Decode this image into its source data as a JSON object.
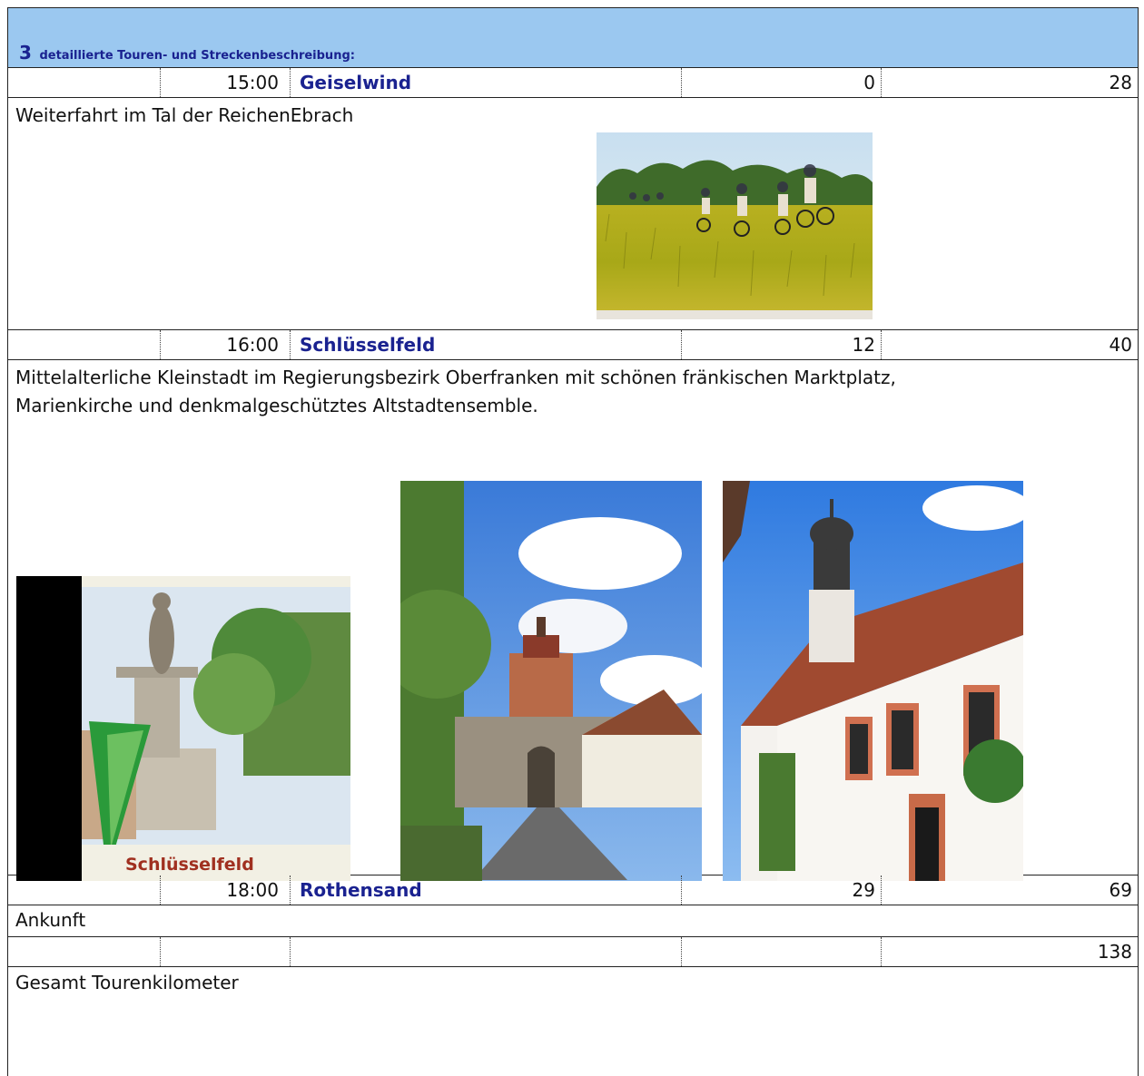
{
  "header": {
    "number": "3",
    "title": "detaillierte Touren- und Streckenbeschreibung:"
  },
  "stops": [
    {
      "time": "15:00",
      "place": "Geiselwind",
      "km": "0",
      "total": "28",
      "description": "Weiterfahrt im Tal der ReichenEbrach"
    },
    {
      "time": "16:00",
      "place": "Schlüsselfeld",
      "km": "12",
      "total": "40",
      "description_line1": "Mittelalterliche Kleinstadt im Regierungsbezirk Oberfranken mit schönen fränkischen Marktplatz,",
      "description_line2": "Marienkirche und denkmalgeschütztes Altstadtensemble.",
      "logo_text": "Schlüsselfeld"
    },
    {
      "time": "18:00",
      "place": "Rothensand",
      "km": "29",
      "total": "69",
      "description": "Ankunft"
    }
  ],
  "summary": {
    "total": "138",
    "label": "Gesamt Tourenkilometer"
  },
  "colors": {
    "header_bg": "#9bc8f0",
    "place_text": "#1a2290"
  }
}
